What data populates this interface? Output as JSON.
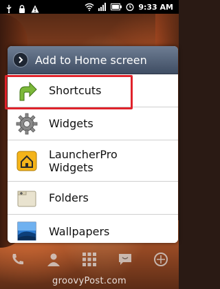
{
  "status_bar": {
    "time": "9:33 AM",
    "icons": [
      "usb-icon",
      "lock-icon",
      "warning-icon",
      "wifi-icon",
      "signal-icon",
      "battery-icon",
      "alarm-icon"
    ]
  },
  "dialog": {
    "title": "Add to Home screen",
    "items": [
      {
        "label": "Shortcuts",
        "icon": "shortcut-arrow-icon"
      },
      {
        "label": "Widgets",
        "icon": "gear-icon"
      },
      {
        "label": "LauncherPro\nWidgets",
        "line1": "LauncherPro",
        "line2": "Widgets",
        "icon": "house-icon"
      },
      {
        "label": "Folders",
        "icon": "folder-icon"
      },
      {
        "label": "Wallpapers",
        "icon": "wallpaper-icon"
      }
    ],
    "highlighted_item": "Shortcuts",
    "colors": {
      "highlight": "#e0222b",
      "header": "#4f5d74"
    }
  },
  "dock": {
    "icons": [
      "phone-icon",
      "contacts-icon",
      "app-drawer-icon",
      "messaging-icon",
      "browser-icon"
    ]
  },
  "watermark": {
    "text": "groovyPost.com"
  }
}
